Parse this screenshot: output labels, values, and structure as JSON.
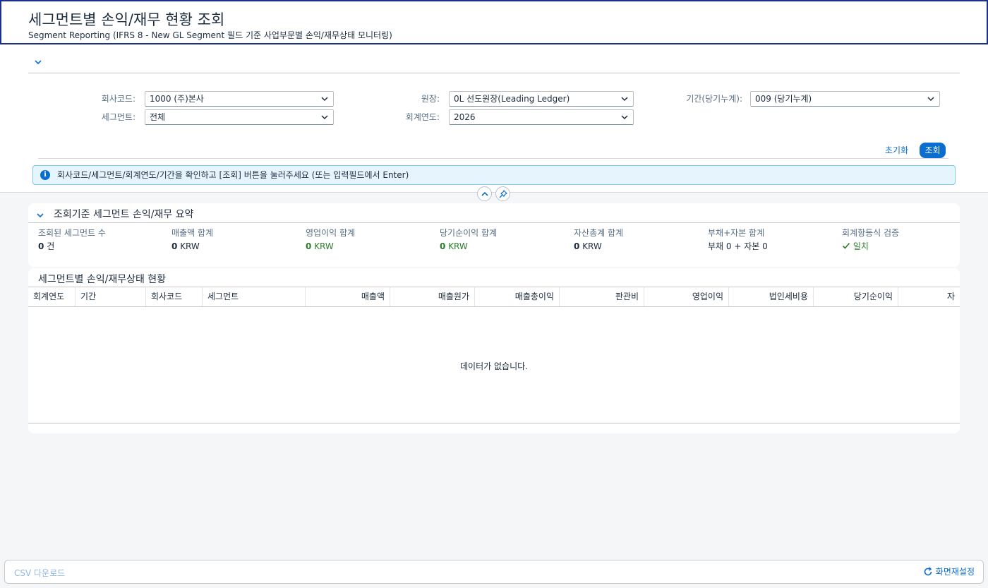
{
  "header": {
    "title": "세그먼트별 손익/재무 현황 조회",
    "subtitle": "Segment Reporting (IFRS 8 - New GL Segment 필드 기준 사업부문별 손익/재무상태 모니터링)"
  },
  "filters": {
    "company_code": {
      "label": "회사코드:",
      "value": "1000 (주)본사"
    },
    "ledger": {
      "label": "원장:",
      "value": "0L 선도원장(Leading Ledger)"
    },
    "period": {
      "label": "기간(당기누계):",
      "value": "009 (당기누계)"
    },
    "segment": {
      "label": "세그먼트:",
      "value": "전체"
    },
    "fiscal_year": {
      "label": "회계연도:",
      "value": "2026"
    },
    "reset_label": "초기화",
    "search_label": "조회"
  },
  "message": "회사코드/세그먼트/회계연도/기간을 확인하고 [조회] 버튼을 눌러주세요 (또는 입력필드에서 Enter)",
  "summary": {
    "title": "조회기준 세그먼트 손익/재무 요약",
    "kpis": [
      {
        "label": "조회된 세그먼트 수",
        "value": "0",
        "unit": "건"
      },
      {
        "label": "매출액 합계",
        "value": "0",
        "unit": "KRW"
      },
      {
        "label": "영업이익 합계",
        "value": "0",
        "unit": "KRW"
      },
      {
        "label": "당기순이익 합계",
        "value": "0",
        "unit": "KRW"
      },
      {
        "label": "자산총계 합계",
        "value": "0",
        "unit": "KRW"
      },
      {
        "label": "부채+자본 합계",
        "value": "부채 0 + 자본 0"
      },
      {
        "label": "회계항등식 검증",
        "value": "일치"
      }
    ]
  },
  "table": {
    "title": "세그먼트별 손익/재무상태 현황",
    "columns": [
      "회계연도",
      "기간",
      "회사코드",
      "세그먼트",
      "매출액",
      "매출원가",
      "매출총이익",
      "판관비",
      "영업이익",
      "법인세비용",
      "당기순이익",
      "자"
    ],
    "empty_text": "데이터가 없습니다."
  },
  "footer": {
    "csv_label": "CSV 다운로드",
    "reset_screen_label": "화면재설정"
  },
  "colors": {
    "accent": "#0a6ed1",
    "positive": "#2b7d2b",
    "header_border": "#1b2f8c"
  }
}
